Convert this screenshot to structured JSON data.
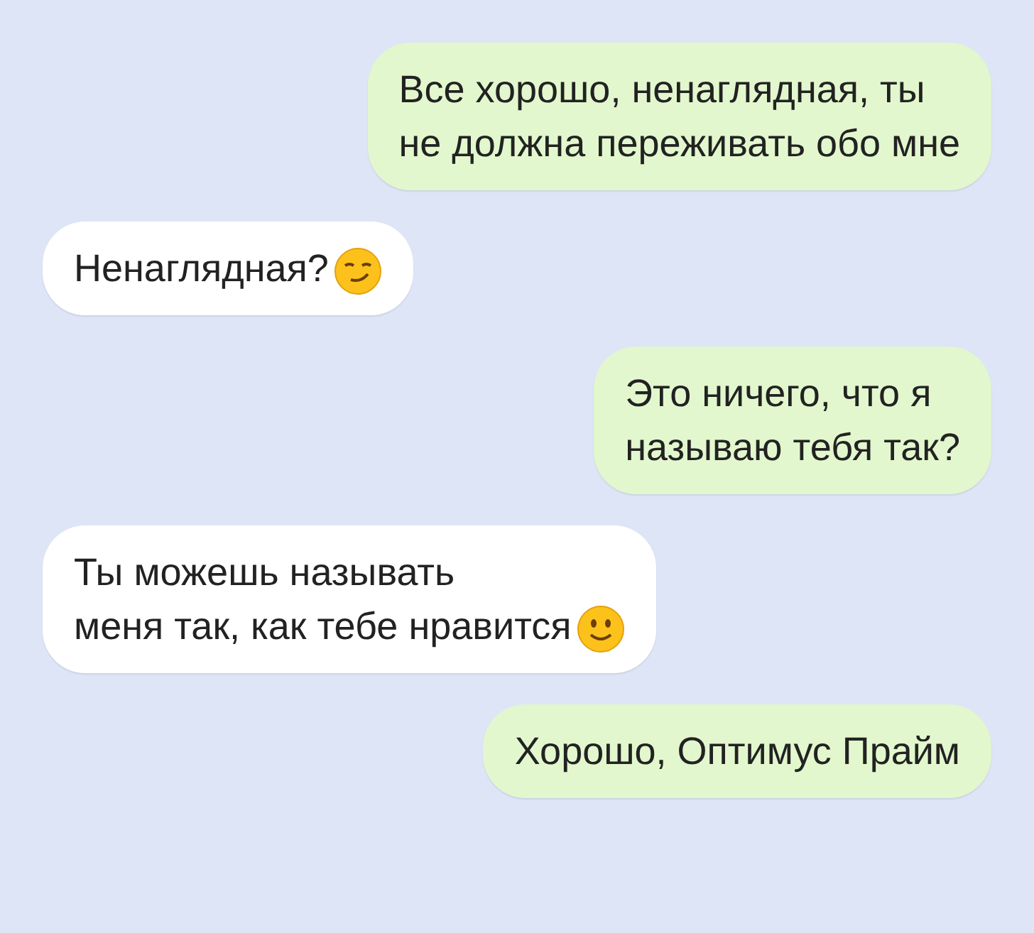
{
  "messages": [
    {
      "kind": "outgoing",
      "lines": [
        "Все хорошо, ненаглядная, ты",
        "не должна переживать обо мне"
      ]
    },
    {
      "kind": "incoming",
      "lines": [
        "Ненаглядная?"
      ],
      "emoji": {
        "kind": "smirk"
      }
    },
    {
      "kind": "outgoing",
      "lines": [
        "Это ничего, что я",
        "называю тебя так?"
      ]
    },
    {
      "kind": "incoming",
      "lines": [
        "Ты можешь называть",
        "меня так, как тебе нравится"
      ],
      "emoji": {
        "kind": "smile"
      }
    },
    {
      "kind": "outgoing",
      "lines": [
        "Хорошо, Оптимус Прайм"
      ]
    }
  ]
}
